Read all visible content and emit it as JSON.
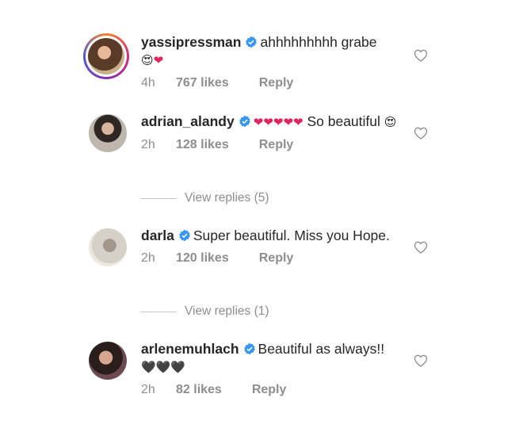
{
  "comments": [
    {
      "username": "yassipressman",
      "text": "ahhhhhhhhh grabe",
      "emojis": [
        "😍",
        "❤"
      ],
      "time": "4h",
      "likes": "767 likes",
      "reply": "Reply"
    },
    {
      "username": "adrian_alandy",
      "text_before": "",
      "emojis_inline": [
        "❤",
        "❤",
        "❤",
        "❤",
        "❤"
      ],
      "text": "So beautiful",
      "emojis": [
        "😍"
      ],
      "time": "2h",
      "likes": "128 likes",
      "reply": "Reply",
      "view_replies": "View replies (5)"
    },
    {
      "username": "darla",
      "text": "Super beautiful. Miss you Hope.",
      "time": "2h",
      "likes": "120 likes",
      "reply": "Reply",
      "view_replies": "View replies (1)"
    },
    {
      "username": "arlenemuhlach",
      "text": "Beautiful as always!!",
      "emojis": [
        "🖤",
        "🖤",
        "🖤"
      ],
      "time": "2h",
      "likes": "82 likes",
      "reply": "Reply"
    }
  ],
  "icons": {
    "verified": "verified-badge-icon",
    "like": "heart-outline-icon"
  },
  "colors": {
    "verified": "#3897f0",
    "meta": "#8e8e8e",
    "heart": "#e0245e"
  }
}
